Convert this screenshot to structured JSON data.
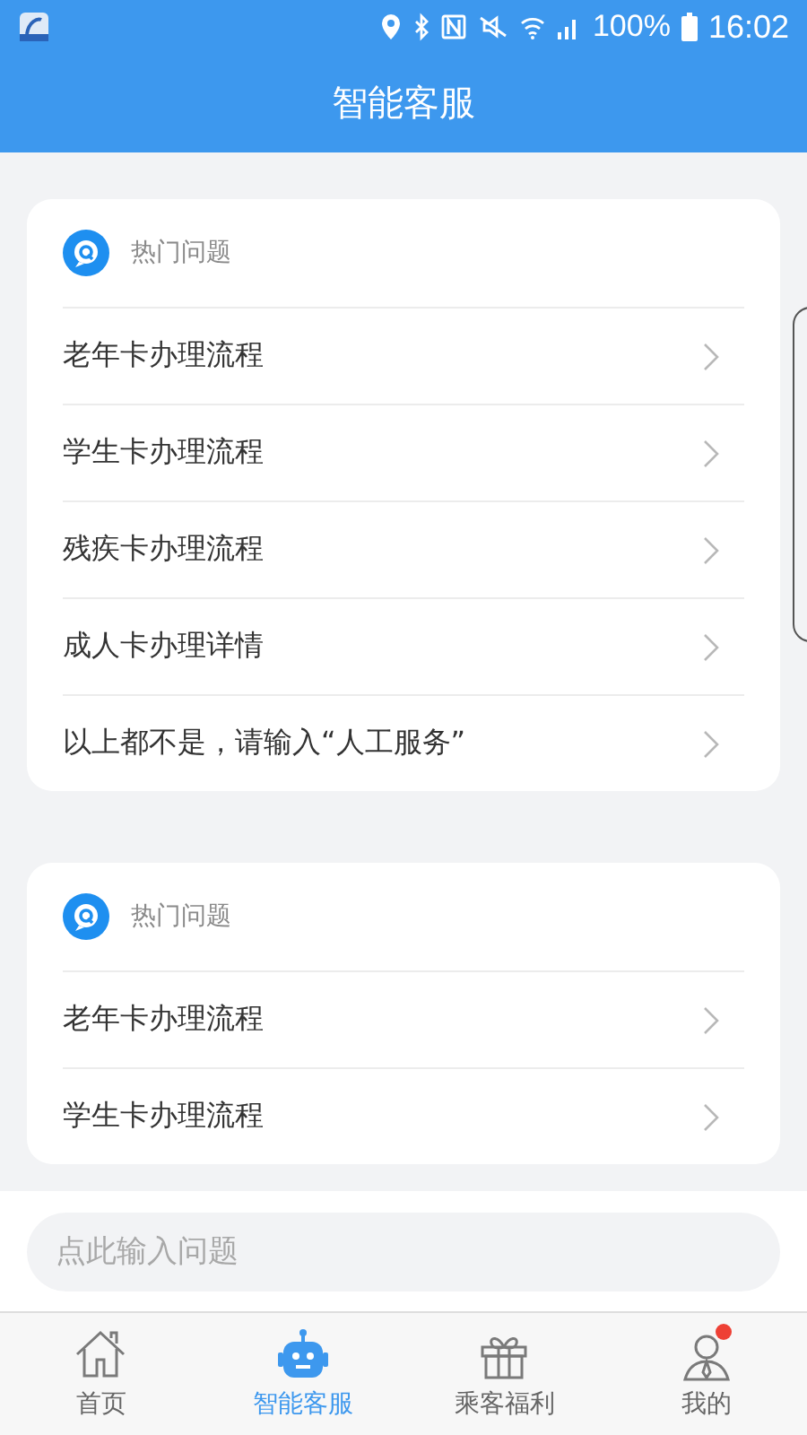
{
  "status_bar": {
    "battery": "100%",
    "time": "16:02"
  },
  "header": {
    "title": "智能客服"
  },
  "sections": [
    {
      "title": "热门问题",
      "questions": [
        "老年卡办理流程",
        "学生卡办理流程",
        "残疾卡办理流程",
        "成人卡办理详情",
        "以上都不是，请输入“人工服务”"
      ]
    },
    {
      "title": "热门问题",
      "questions": [
        "老年卡办理流程",
        "学生卡办理流程"
      ]
    }
  ],
  "input": {
    "placeholder": "点此输入问题"
  },
  "tabs": [
    {
      "kind": "home",
      "label": "首页",
      "selected": false,
      "dot": false
    },
    {
      "kind": "robot",
      "label": "智能客服",
      "selected": true,
      "dot": false
    },
    {
      "kind": "gift",
      "label": "乘客福利",
      "selected": false,
      "dot": false
    },
    {
      "kind": "user",
      "label": "我的",
      "selected": false,
      "dot": true
    }
  ]
}
